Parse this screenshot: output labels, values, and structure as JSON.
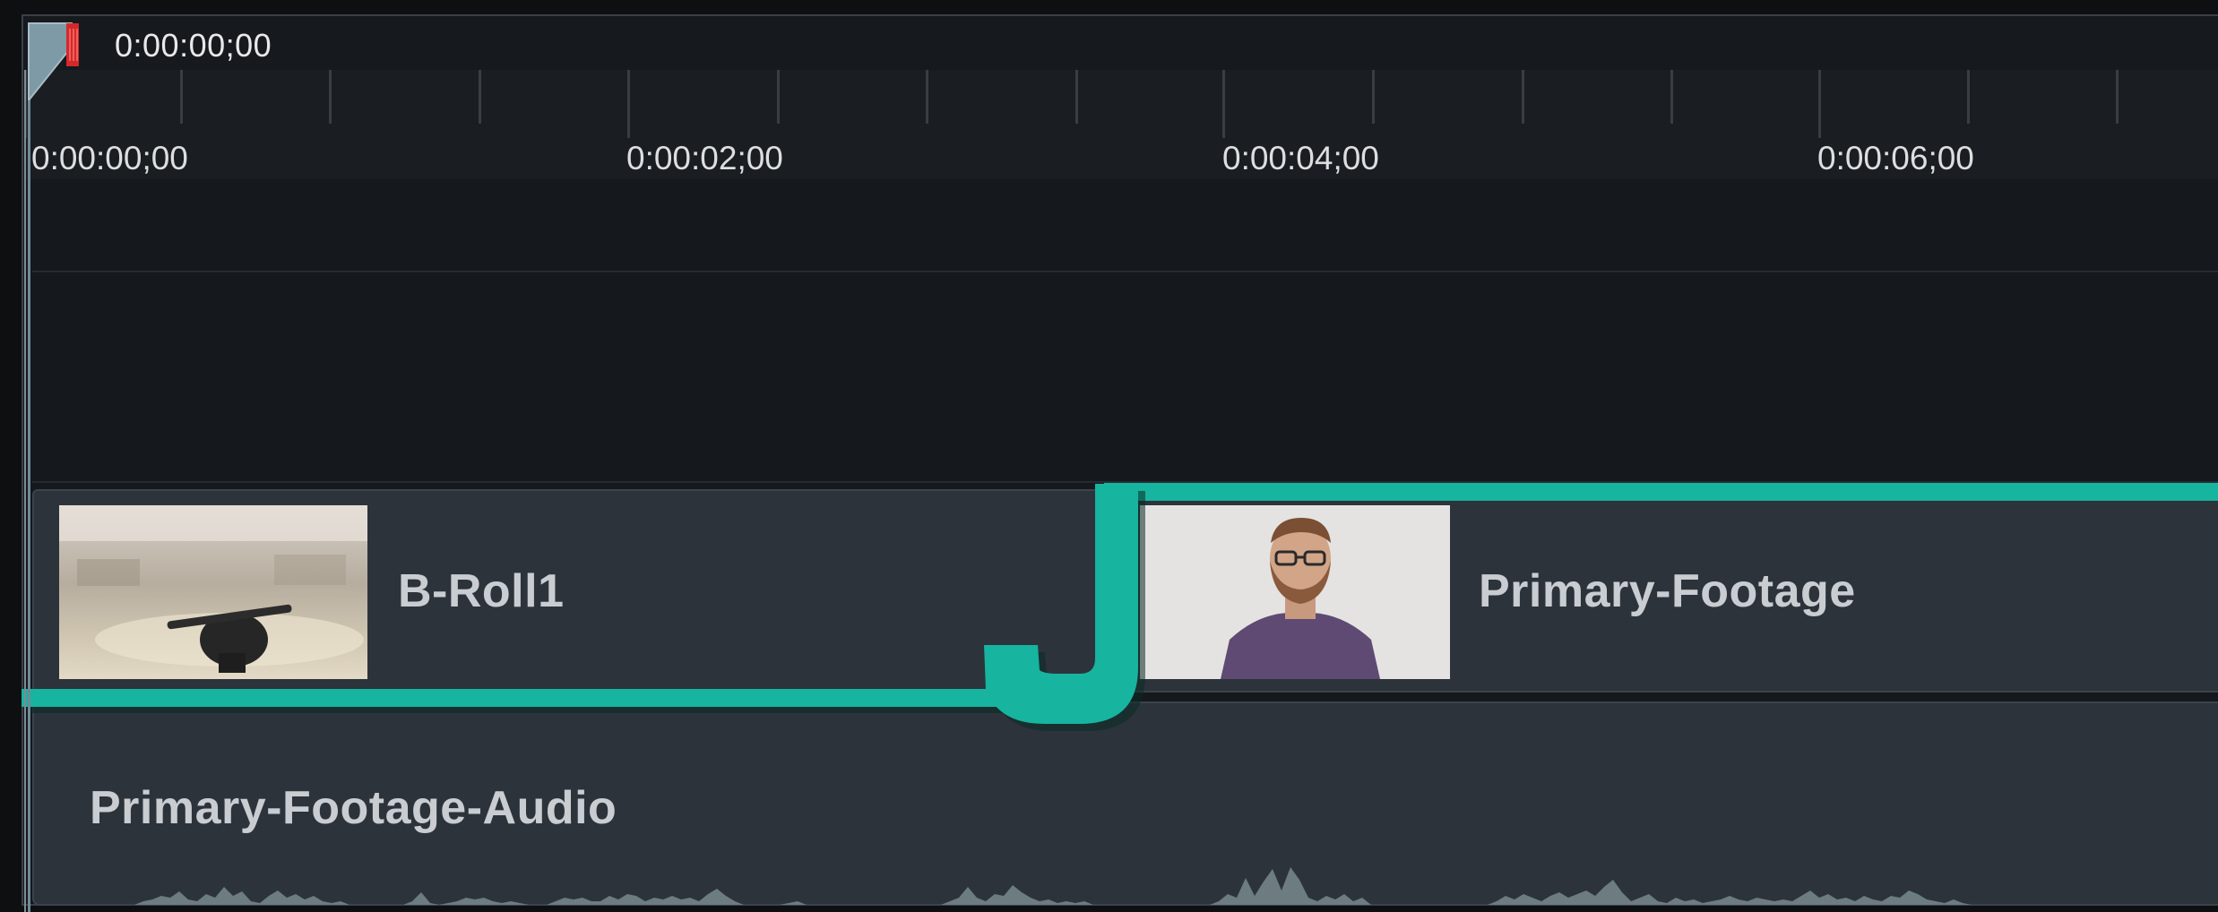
{
  "playhead": {
    "time": "0:00:00;00"
  },
  "ruler": {
    "labels": [
      "0:00:00;00",
      "0:00:02;00",
      "0:00:04;00",
      "0:00:06;00"
    ]
  },
  "tracks": {
    "video": {
      "clips": [
        {
          "label": "B-Roll1",
          "thumbnail": "b-roll-desk-thumbnail"
        },
        {
          "label": "Primary-Footage",
          "thumbnail": "man-on-camera-thumbnail"
        }
      ]
    },
    "audio": {
      "clips": [
        {
          "label": "Primary-Footage-Audio"
        }
      ]
    }
  },
  "colors": {
    "accent": "#17b4a0",
    "clip": "#2c333b",
    "waveform": "#6c7c80",
    "playhead_marker": "#c62020"
  },
  "icons": {
    "playhead": "playhead-icon",
    "cut_marker": "j-cut-marker"
  }
}
